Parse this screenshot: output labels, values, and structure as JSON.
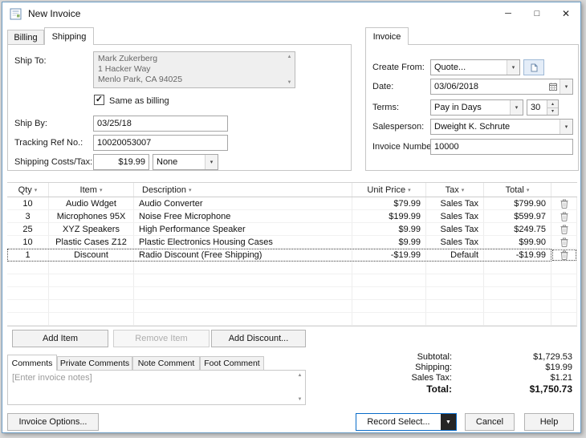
{
  "window": {
    "title": "New Invoice"
  },
  "icons": {
    "sort_chevron": "▾",
    "combo_arrow": "▾",
    "spin_up": "▴",
    "spin_down": "▾",
    "scroll_up": "▲",
    "scroll_down": "▼",
    "check": "✓",
    "minimize": "─",
    "maximize": "□",
    "close": "✕",
    "record_arrow": "▼"
  },
  "left_tabs": {
    "billing": "Billing",
    "shipping": "Shipping"
  },
  "shipping_panel": {
    "ship_to_label": "Ship To:",
    "ship_to_address": "Mark Zukerberg\n1 Hacker Way\nMenlo Park, CA 94025",
    "same_as_billing_label": "Same as billing",
    "ship_by_label": "Ship By:",
    "ship_by_value": "03/25/18",
    "tracking_label": "Tracking Ref No.:",
    "tracking_value": "10020053007",
    "shipping_costs_label": "Shipping Costs/Tax:",
    "shipping_costs_value": "$19.99",
    "shipping_tax_value": "None"
  },
  "invoice_tab_label": "Invoice",
  "invoice_panel": {
    "create_from_label": "Create From:",
    "create_from_value": "Quote...",
    "date_label": "Date:",
    "date_value": "03/06/2018",
    "terms_label": "Terms:",
    "terms_value": "Pay in Days",
    "terms_days": "30",
    "salesperson_label": "Salesperson:",
    "salesperson_value": "Dweight K. Schrute",
    "invoice_number_label": "Invoice Number:",
    "invoice_number_value": "10000"
  },
  "table": {
    "headers": {
      "qty": "Qty",
      "item": "Item",
      "description": "Description",
      "unit_price": "Unit Price",
      "tax": "Tax",
      "total": "Total"
    },
    "rows": [
      {
        "qty": "10",
        "item": "Audio Wdget",
        "description": "Audio Converter",
        "unit_price": "$79.99",
        "tax": "Sales Tax",
        "total": "$799.90"
      },
      {
        "qty": "3",
        "item": "Microphones 95X",
        "description": "Noise Free Microphone",
        "unit_price": "$199.99",
        "tax": "Sales Tax",
        "total": "$599.97"
      },
      {
        "qty": "25",
        "item": "XYZ Speakers",
        "description": "High Performance Speaker",
        "unit_price": "$9.99",
        "tax": "Sales Tax",
        "total": "$249.75"
      },
      {
        "qty": "10",
        "item": "Plastic Cases Z12",
        "description": "Plastic Electronics Housing Cases",
        "unit_price": "$9.99",
        "tax": "Sales Tax",
        "total": "$99.90"
      },
      {
        "qty": "1",
        "item": "Discount",
        "description": "Radio Discount (Free Shipping)",
        "unit_price": "-$19.99",
        "tax": "Default",
        "total": "-$19.99"
      }
    ]
  },
  "item_buttons": {
    "add_item": "Add Item",
    "remove_item": "Remove Item",
    "add_discount": "Add Discount..."
  },
  "comments": {
    "tabs": [
      "Comments",
      "Private Comments",
      "Note Comment",
      "Foot Comment"
    ],
    "placeholder": "[Enter invoice notes]"
  },
  "totals": {
    "subtotal_label": "Subtotal:",
    "subtotal": "$1,729.53",
    "shipping_label": "Shipping:",
    "shipping": "$19.99",
    "sales_tax_label": "Sales Tax:",
    "sales_tax": "$1.21",
    "total_label": "Total:",
    "total": "$1,750.73"
  },
  "footer": {
    "invoice_options": "Invoice Options...",
    "record_select": "Record Select...",
    "cancel": "Cancel",
    "help": "Help"
  },
  "colors": {
    "accent": "#0a6cc9",
    "window_border": "#6a9bc3"
  }
}
